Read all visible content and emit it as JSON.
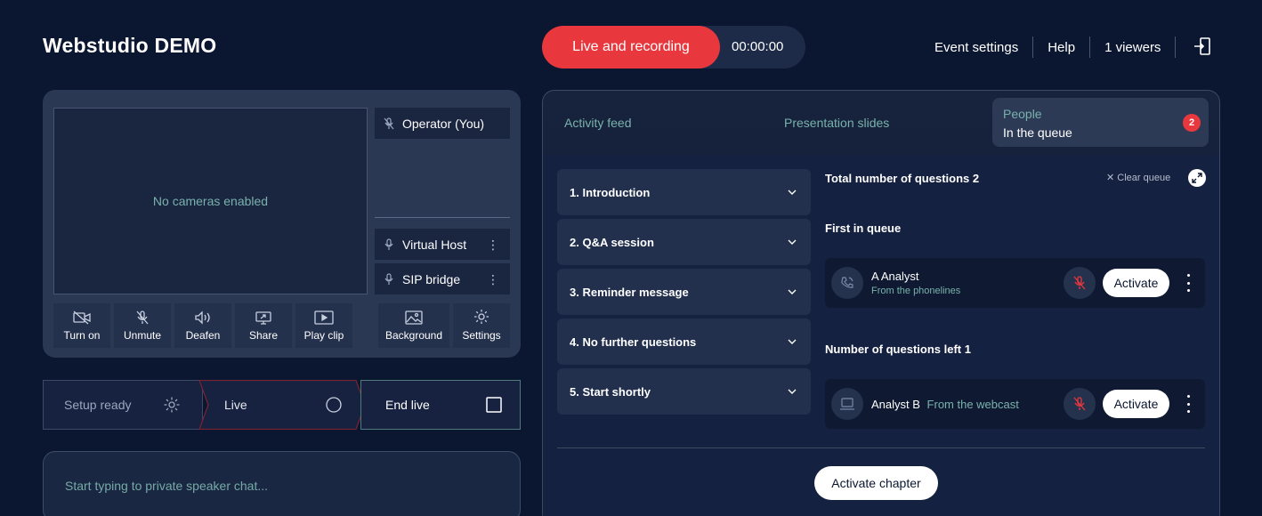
{
  "header": {
    "title": "Webstudio DEMO",
    "live_button_label": "Live and recording",
    "timer": "00:00:00",
    "links": [
      "Event settings",
      "Help",
      "1 viewers"
    ],
    "exit_icon": "exit-icon",
    "live_color": "#e8383d"
  },
  "video": {
    "placeholder": "No cameras enabled",
    "participants": [
      {
        "name": "Operator (You)",
        "icon": "mic-off-icon"
      },
      {
        "name": "Virtual Host",
        "icon": "mic-icon"
      },
      {
        "name": "SIP bridge",
        "icon": "mic-icon"
      }
    ],
    "controls": [
      {
        "label": "Turn on",
        "icon": "camera-off-icon"
      },
      {
        "label": "Unmute",
        "icon": "mic-off-icon"
      },
      {
        "label": "Deafen",
        "icon": "speaker-icon"
      },
      {
        "label": "Share",
        "icon": "screen-share-icon"
      },
      {
        "label": "Play clip",
        "icon": "play-clip-icon"
      },
      {
        "label": "Background",
        "icon": "image-icon"
      },
      {
        "label": "Settings",
        "icon": "gear-icon"
      }
    ]
  },
  "stepper": {
    "setup": "Setup ready",
    "live": "Live",
    "end": "End live"
  },
  "chat": {
    "placeholder": "Start typing to private speaker chat..."
  },
  "tabs": {
    "activity": "Activity feed",
    "slides": "Presentation slides",
    "people_title": "People",
    "people_subtitle": "In the queue",
    "people_badge": "2"
  },
  "chapters": [
    "1. Introduction",
    "2. Q&A session",
    "3. Reminder message",
    "4. No further questions",
    "5. Start shortly"
  ],
  "queue": {
    "total_label": "Total number of questions 2",
    "clear_label": "Clear queue",
    "first_label": "First in queue",
    "left_label": "Number of questions left 1",
    "first_item": {
      "name": "A Analyst",
      "source": "From the phonelines",
      "action": "Activate",
      "icon": "phone-icon"
    },
    "second_item": {
      "name": "Analyst B",
      "source": "From the webcast",
      "action": "Activate",
      "icon": "laptop-icon"
    },
    "activate_chapter": "Activate chapter"
  }
}
